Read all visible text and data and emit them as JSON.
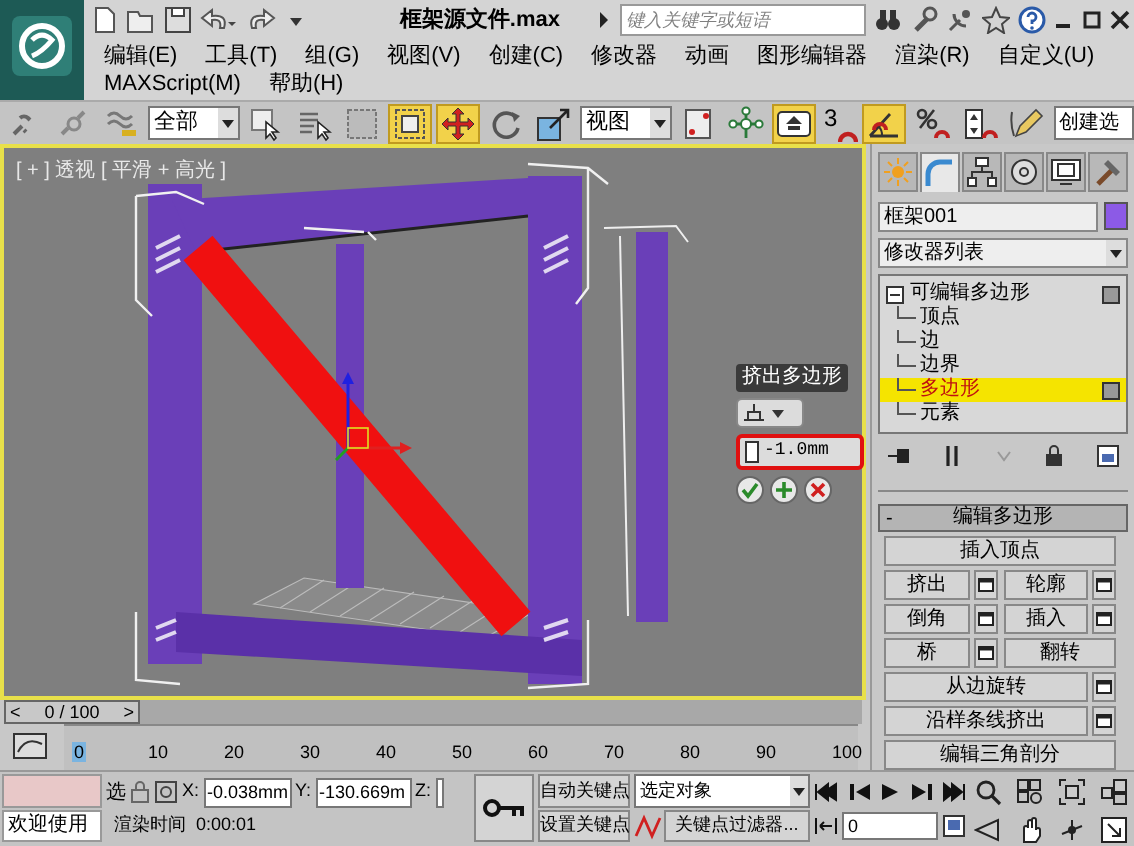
{
  "title_bar": {
    "file_name": "框架源文件.max",
    "search_placeholder": "键入关键字或短语"
  },
  "menu": [
    "编辑(E)",
    "工具(T)",
    "组(G)",
    "视图(V)",
    "创建(C)",
    "修改器",
    "动画",
    "图形编辑器",
    "渲染(R)",
    "自定义(U)",
    "MAXScript(M)",
    "帮助(H)"
  ],
  "toolbar": [
    {
      "kind": "tool",
      "selected": false
    },
    {
      "kind": "tool",
      "selected": false
    },
    {
      "kind": "tool",
      "selected": false
    },
    {
      "kind": "dropdown",
      "value": "全部"
    },
    {
      "kind": "tool",
      "selected": false
    },
    {
      "kind": "tool",
      "selected": false
    },
    {
      "kind": "tool",
      "selected": false
    },
    {
      "kind": "tool",
      "selected": true
    },
    {
      "kind": "tool",
      "selected": true
    },
    {
      "kind": "tool",
      "selected": false
    },
    {
      "kind": "tool",
      "selected": false
    },
    {
      "kind": "dropdown",
      "value": "视图"
    },
    {
      "kind": "tool",
      "selected": false
    },
    {
      "kind": "tool",
      "selected": false
    },
    {
      "kind": "tool",
      "selected": true
    },
    {
      "kind": "snap",
      "label": "3",
      "selected": false
    },
    {
      "kind": "tool",
      "selected": true
    },
    {
      "kind": "tool",
      "selected": false
    },
    {
      "kind": "tool",
      "selected": false
    },
    {
      "kind": "tool",
      "selected": false
    },
    {
      "kind": "field",
      "value": "创建选"
    }
  ],
  "viewport": {
    "label": "[ + ] 透视 [ 平滑 + 高光 ]",
    "active": true,
    "caddy": {
      "title": "挤出多边形",
      "value": "-1.0mm",
      "highlighted": true
    }
  },
  "command_panel": {
    "tabs": [
      {
        "selected": false
      },
      {
        "selected": true
      },
      {
        "selected": false
      },
      {
        "selected": false
      },
      {
        "selected": false
      },
      {
        "selected": false
      }
    ],
    "object_name": "框架001",
    "modifier_list": "修改器列表",
    "stack": [
      {
        "label": "可编辑多边形",
        "expanded": true,
        "children": [
          {
            "label": "顶点",
            "selected": false
          },
          {
            "label": "边",
            "selected": false
          },
          {
            "label": "边界",
            "selected": false
          },
          {
            "label": "多边形",
            "selected": true
          },
          {
            "label": "元素",
            "selected": false
          }
        ]
      }
    ],
    "rollout": {
      "sign": "-",
      "title": "编辑多边形",
      "rows": [
        [
          {
            "label": "插入顶点",
            "settings": false
          }
        ],
        [
          {
            "label": "挤出",
            "settings": true
          },
          {
            "label": "轮廓",
            "settings": true
          }
        ],
        [
          {
            "label": "倒角",
            "settings": true
          },
          {
            "label": "插入",
            "settings": true
          }
        ],
        [
          {
            "label": "桥",
            "settings": true
          },
          {
            "label": "翻转",
            "settings": false
          }
        ],
        [
          {
            "label": "从边旋转",
            "settings": true
          }
        ],
        [
          {
            "label": "沿样条线挤出",
            "settings": true
          }
        ],
        [
          {
            "label": "编辑三角剖分",
            "settings": false
          }
        ]
      ]
    }
  },
  "time_slider": {
    "prev": "<",
    "position": "0 / 100",
    "next": ">",
    "level": 0
  },
  "ruler": [
    "0",
    "10",
    "20",
    "30",
    "40",
    "50",
    "60",
    "70",
    "80",
    "90",
    "100"
  ],
  "status": {
    "welcome": "欢迎使用",
    "select_label": "选",
    "x_label": "X:",
    "x_value": "-0.038mm",
    "y_label": "Y:",
    "y_value": "-130.669m",
    "z_label": "Z:",
    "render_time_label": "渲染时间",
    "render_time": "0:00:01",
    "auto_key": "自动关键点",
    "set_key": "设置关键点",
    "key_mode": "选定对象",
    "key_filters": "关键点过滤器...",
    "frame": "0"
  }
}
